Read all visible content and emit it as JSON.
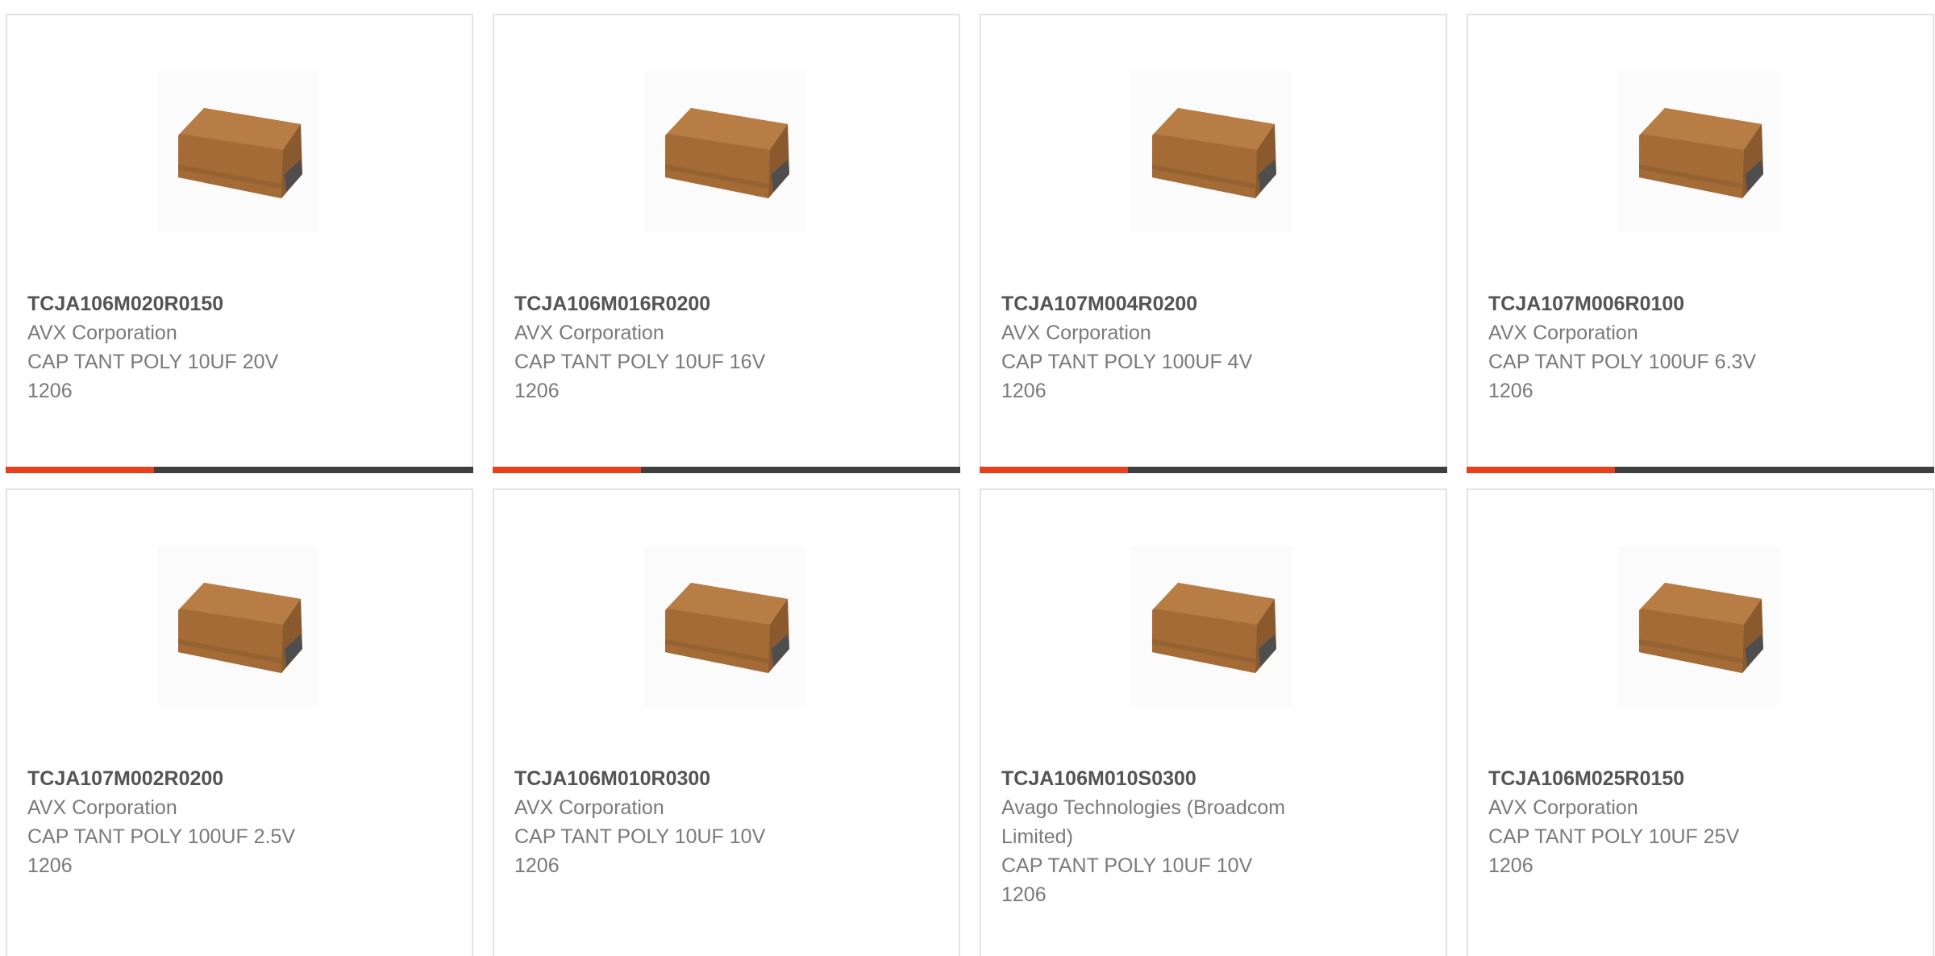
{
  "colors": {
    "accent": "#e8401c",
    "bar": "#3f3f3f",
    "border": "#e3e3e3",
    "part_text": "#545454",
    "detail_text": "#7a7a7a"
  },
  "products": [
    {
      "part_number": "TCJA106M020R0150",
      "manufacturer": "AVX Corporation",
      "description": "CAP TANT POLY 10UF 20V",
      "package": "1206",
      "image_icon": "tantalum-capacitor-icon"
    },
    {
      "part_number": "TCJA106M016R0200",
      "manufacturer": "AVX Corporation",
      "description": "CAP TANT POLY 10UF 16V",
      "package": "1206",
      "image_icon": "tantalum-capacitor-icon"
    },
    {
      "part_number": "TCJA107M004R0200",
      "manufacturer": "AVX Corporation",
      "description": "CAP TANT POLY 100UF 4V",
      "package": "1206",
      "image_icon": "tantalum-capacitor-icon"
    },
    {
      "part_number": "TCJA107M006R0100",
      "manufacturer": "AVX Corporation",
      "description": "CAP TANT POLY 100UF 6.3V",
      "package": "1206",
      "image_icon": "tantalum-capacitor-icon"
    },
    {
      "part_number": "TCJA107M002R0200",
      "manufacturer": "AVX Corporation",
      "description": "CAP TANT POLY 100UF 2.5V",
      "package": "1206",
      "image_icon": "tantalum-capacitor-icon"
    },
    {
      "part_number": "TCJA106M010R0300",
      "manufacturer": "AVX Corporation",
      "description": "CAP TANT POLY 10UF 10V",
      "package": "1206",
      "image_icon": "tantalum-capacitor-icon"
    },
    {
      "part_number": "TCJA106M010S0300",
      "manufacturer": "Avago Technologies (Broadcom Limited)",
      "description": "CAP TANT POLY 10UF 10V",
      "package": "1206",
      "image_icon": "tantalum-capacitor-icon"
    },
    {
      "part_number": "TCJA106M025R0150",
      "manufacturer": "AVX Corporation",
      "description": "CAP TANT POLY 10UF 25V",
      "package": "1206",
      "image_icon": "tantalum-capacitor-icon"
    }
  ]
}
